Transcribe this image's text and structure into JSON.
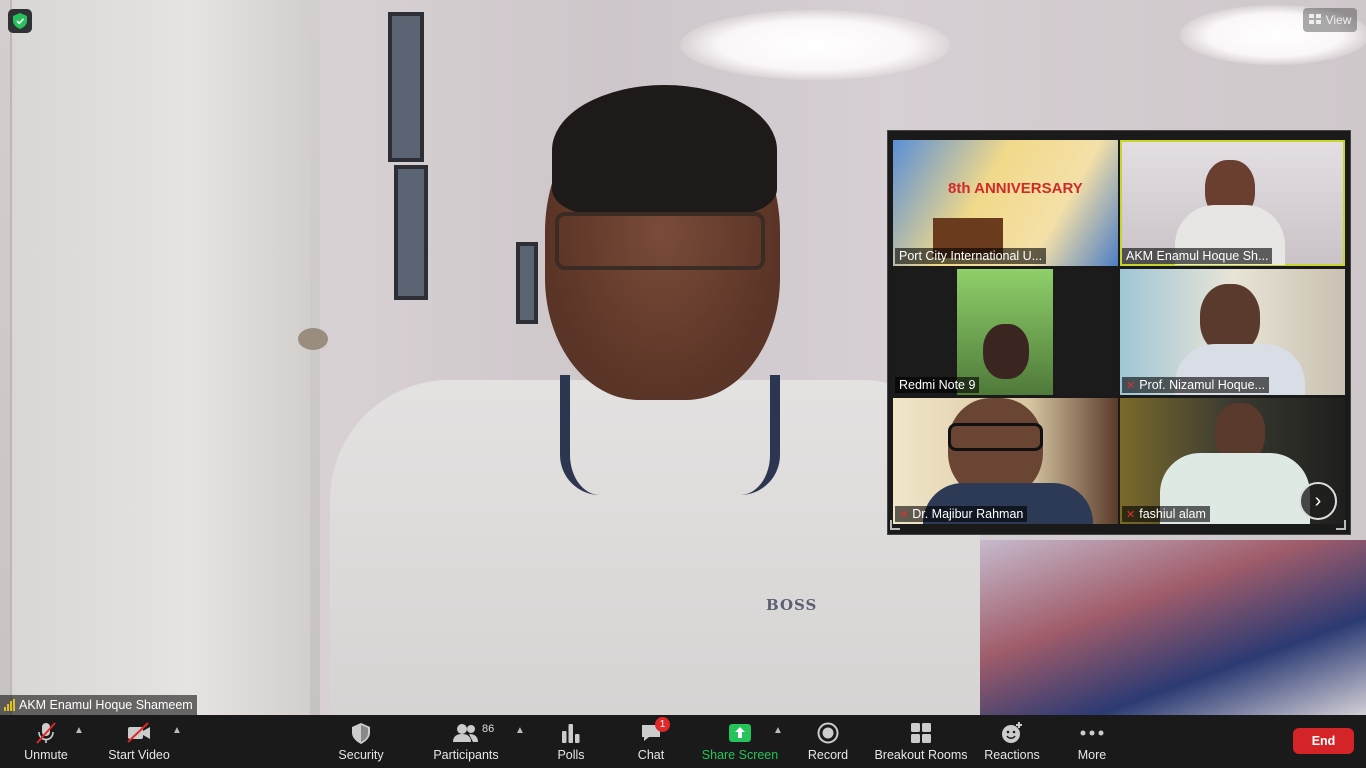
{
  "top": {
    "view_label": "View"
  },
  "self_view": {
    "name": "AKM Enamul Hoque Shameem",
    "shirt_logo": "BOSS"
  },
  "gallery": {
    "tiles": [
      {
        "name": "Port City International U...",
        "muted": false,
        "banner": "8th ANNIVERSARY"
      },
      {
        "name": "AKM Enamul Hoque Sh...",
        "muted": false,
        "active": true
      },
      {
        "name": "Redmi Note 9",
        "muted": false
      },
      {
        "name": "Prof. Nizamul Hoque...",
        "muted": true
      },
      {
        "name": "Dr. Majibur Rahman",
        "muted": true
      },
      {
        "name": "fashiul alam",
        "muted": true
      }
    ]
  },
  "toolbar": {
    "unmute": "Unmute",
    "start_video": "Start Video",
    "security": "Security",
    "participants": "Participants",
    "participants_count": "86",
    "polls": "Polls",
    "chat": "Chat",
    "chat_badge": "1",
    "share_screen": "Share Screen",
    "record": "Record",
    "breakout_rooms": "Breakout Rooms",
    "reactions": "Reactions",
    "more": "More",
    "end": "End"
  },
  "colors": {
    "toolbar_bg": "#1a1a1a",
    "end_red": "#d42427",
    "share_green": "#26c35a",
    "active_speaker": "#c9d629",
    "muted_red": "#e0302f"
  }
}
